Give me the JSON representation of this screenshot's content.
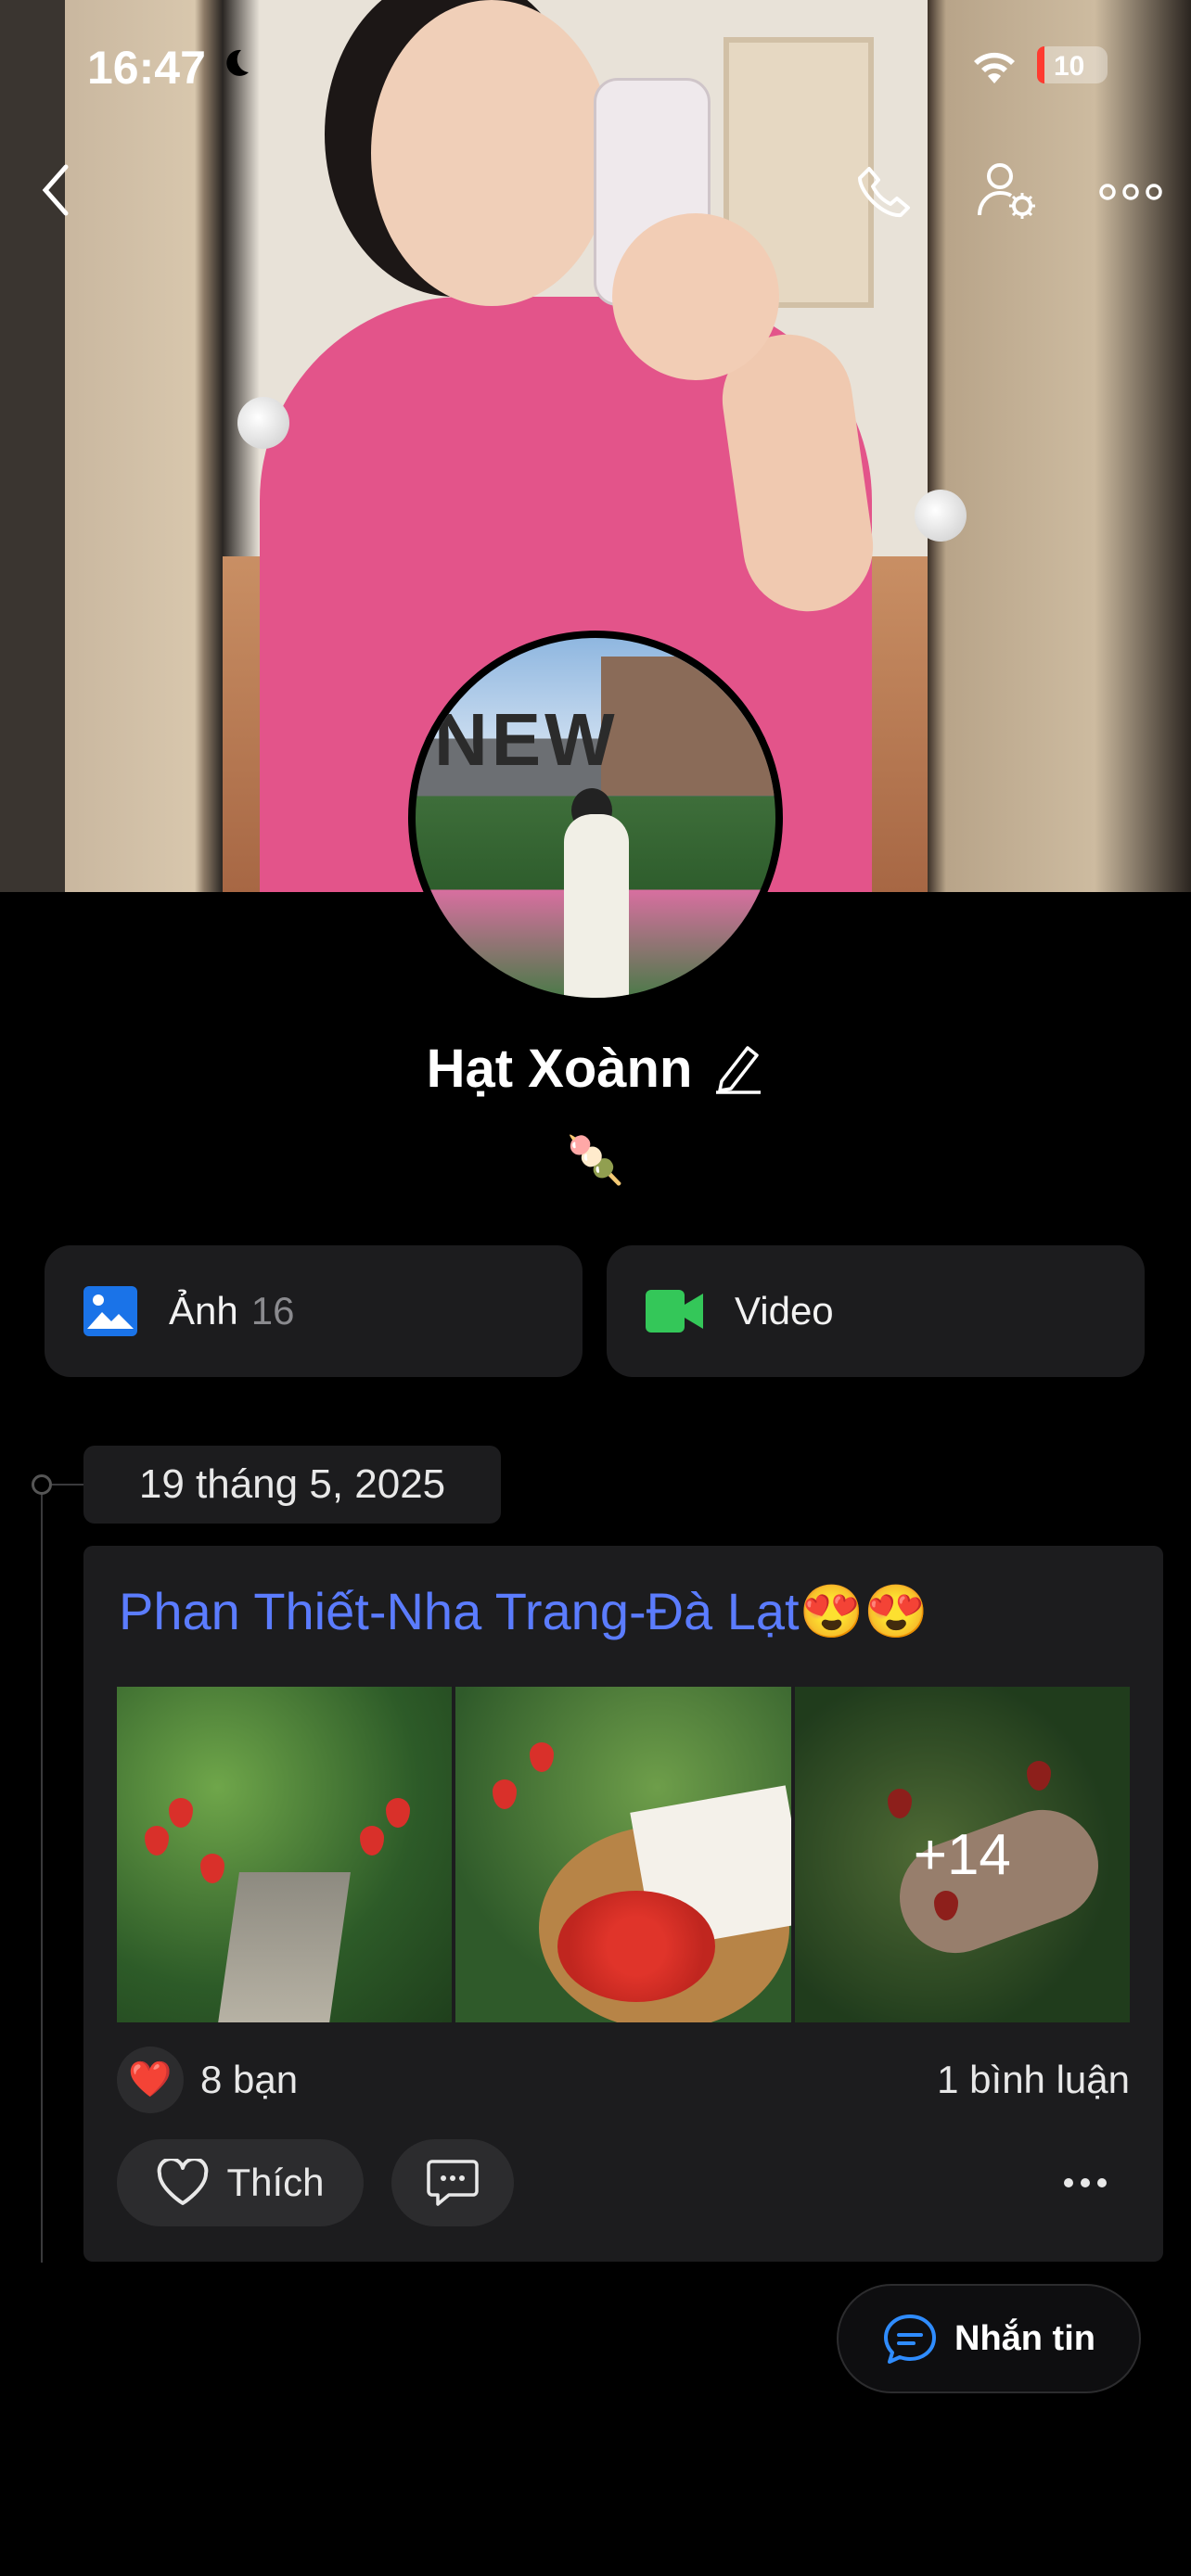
{
  "status_bar": {
    "time": "16:47",
    "battery": "10"
  },
  "profile": {
    "name": "Hạt Xoànn",
    "bio": "🍡"
  },
  "media_tiles": {
    "photos_label": "Ảnh",
    "photos_count": "16",
    "video_label": "Video"
  },
  "timeline": {
    "date": "19 tháng 5, 2025",
    "post": {
      "title": "Phan Thiết-Nha Trang-Đà Lạt😍😍",
      "more_photos": "+14",
      "reaction_emoji": "❤️",
      "reaction_count": "8 bạn",
      "comment_count": "1 bình luận",
      "like_label": "Thích"
    }
  },
  "message_button": {
    "label": "Nhắn tin"
  },
  "colors": {
    "accent_blue": "#5b7cff",
    "video_green": "#34c759",
    "photo_blue": "#1a73e8"
  }
}
